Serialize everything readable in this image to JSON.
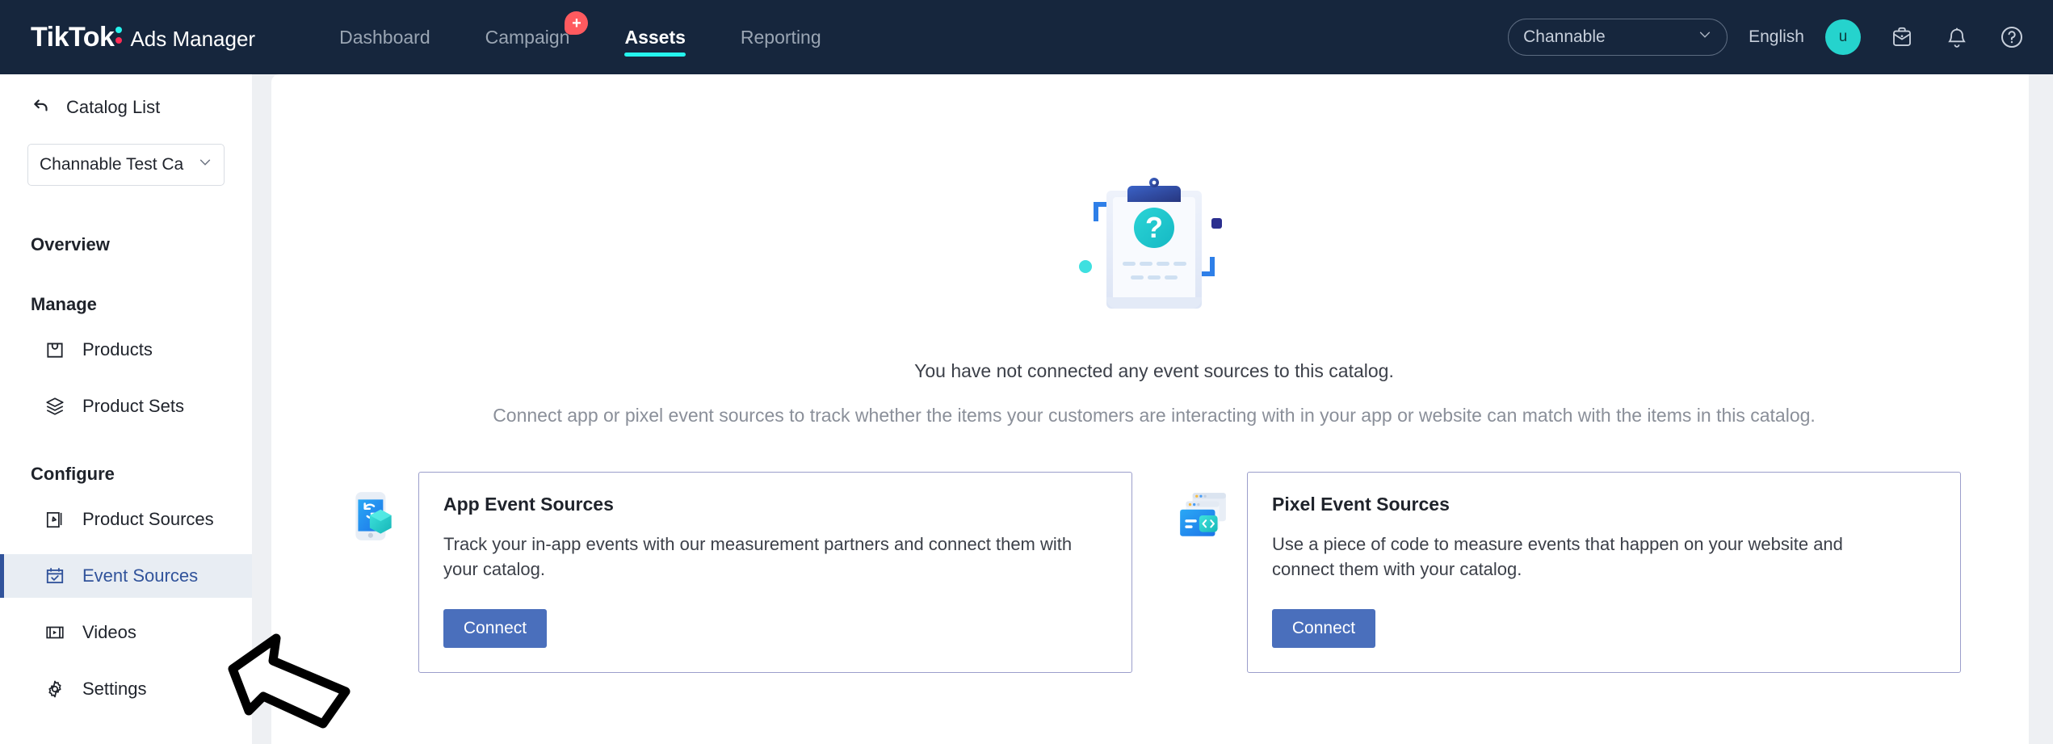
{
  "header": {
    "brand_tiktok": "TikTok",
    "brand_suffix": "Ads Manager",
    "nav": [
      {
        "label": "Dashboard",
        "active": false,
        "badge": ""
      },
      {
        "label": "Campaign",
        "active": false,
        "badge": "+"
      },
      {
        "label": "Assets",
        "active": true,
        "badge": ""
      },
      {
        "label": "Reporting",
        "active": false,
        "badge": ""
      }
    ],
    "account_select": "Channable",
    "language": "English",
    "avatar_initial": "u",
    "icons": [
      "inbox-icon",
      "bell-icon",
      "help-icon"
    ],
    "colors": {
      "background": "#16263d",
      "active_underline": "#25f4ee",
      "badge": "#ff5a5f",
      "avatar": "#25d3cd"
    }
  },
  "sidebar": {
    "back_label": "Catalog List",
    "catalog_select": "Channable Test Ca",
    "sections": [
      {
        "title": "Overview",
        "items": []
      },
      {
        "title": "Manage",
        "items": [
          {
            "label": "Products",
            "icon": "shopping-bag-icon",
            "active": false
          },
          {
            "label": "Product Sets",
            "icon": "layers-icon",
            "active": false
          }
        ]
      },
      {
        "title": "Configure",
        "items": [
          {
            "label": "Product Sources",
            "icon": "document-pen-icon",
            "active": false
          },
          {
            "label": "Event Sources",
            "icon": "calendar-check-icon",
            "active": true
          },
          {
            "label": "Videos",
            "icon": "film-icon",
            "active": false
          },
          {
            "label": "Settings",
            "icon": "gear-icon",
            "active": false
          }
        ]
      }
    ],
    "active_color": "#31539b",
    "active_background": "#e8edf3"
  },
  "main": {
    "empty_title": "You have not connected any event sources to this catalog.",
    "empty_subtitle": "Connect app or pixel event sources to track whether the items your customers are interacting with in your app or website can match with the items in this catalog.",
    "illustration": "clipboard-question-illustration",
    "cards": [
      {
        "icon": "mobile-app-events-icon",
        "title": "App Event Sources",
        "description": "Track your in-app events with our measurement partners and connect them with your catalog.",
        "button": "Connect"
      },
      {
        "icon": "browser-code-pixel-icon",
        "title": "Pixel Event Sources",
        "description": "Use a piece of code to measure events that happen on your website and connect them with your catalog.",
        "button": "Connect"
      }
    ],
    "card_border_color": "#9b9ecb",
    "button_color": "#4a6fbc"
  },
  "overlay": {
    "cursor": "arrow-cursor-pointing-up-left"
  }
}
